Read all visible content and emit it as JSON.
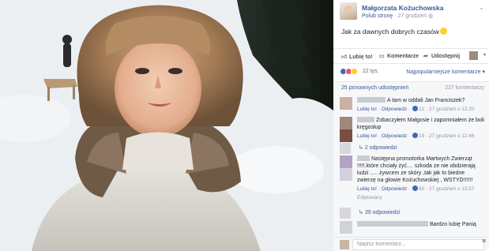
{
  "post": {
    "author": "Małgorzata Kożuchowska",
    "like_page": "Polub stronę",
    "separator": "·",
    "date": "27 grudzień",
    "text": "Jak za dawnych dobrych czasów",
    "emoji": "smiling-face-icon"
  },
  "actions": {
    "like": "Lubię to!",
    "comment": "Komentarze",
    "share": "Udostępnij"
  },
  "reactions": {
    "count": "22 tys.",
    "sort_label": "Najpopularniejsze komentarze",
    "icons": [
      "like-icon",
      "love-icon",
      "haha-icon"
    ]
  },
  "shares": {
    "shares_label": "25 ponownych udostępnień",
    "comments_count": "227 komentarzy"
  },
  "comments": [
    {
      "text": "A tam w oddali Jan Franciszek?",
      "like": "Lubię to!",
      "reply": "Odpowiedz",
      "likes": "12",
      "time": "27 grudzień o 12:20"
    },
    {
      "text": "Zobaczyłem Małgosie i zapomniałem że boli kręgosłup",
      "like": "Lubię to!",
      "reply": "Odpowiedz",
      "likes": "19",
      "time": "27 grudzień o 12:46",
      "replies": "2 odpowiedzi"
    },
    {
      "text": "Następna promotorka Martwych Zwierząt !!!!!.które chciały żyć.... szkoda ze nie obdzierają ludzi ..... żywcem ze skóry ,tak jak to biedne zwierzę na głowie Kożuchowskiej , WSTYD!!!!!!",
      "like": "Lubię to!",
      "reply": "Odpowiedz",
      "likes": "60",
      "time": "27 grudzień o 13:57",
      "edited": "Edytowany",
      "replies": "39 odpowiedzi"
    },
    {
      "text": "Bardzo lubię Panią"
    }
  ],
  "composer": {
    "placeholder": "Napisz komentarz..."
  },
  "colors": {
    "link": "#365899",
    "meta": "#90949c",
    "like_blue": "#4267b2",
    "love_red": "#f25268",
    "haha_yellow": "#ffcc33"
  }
}
